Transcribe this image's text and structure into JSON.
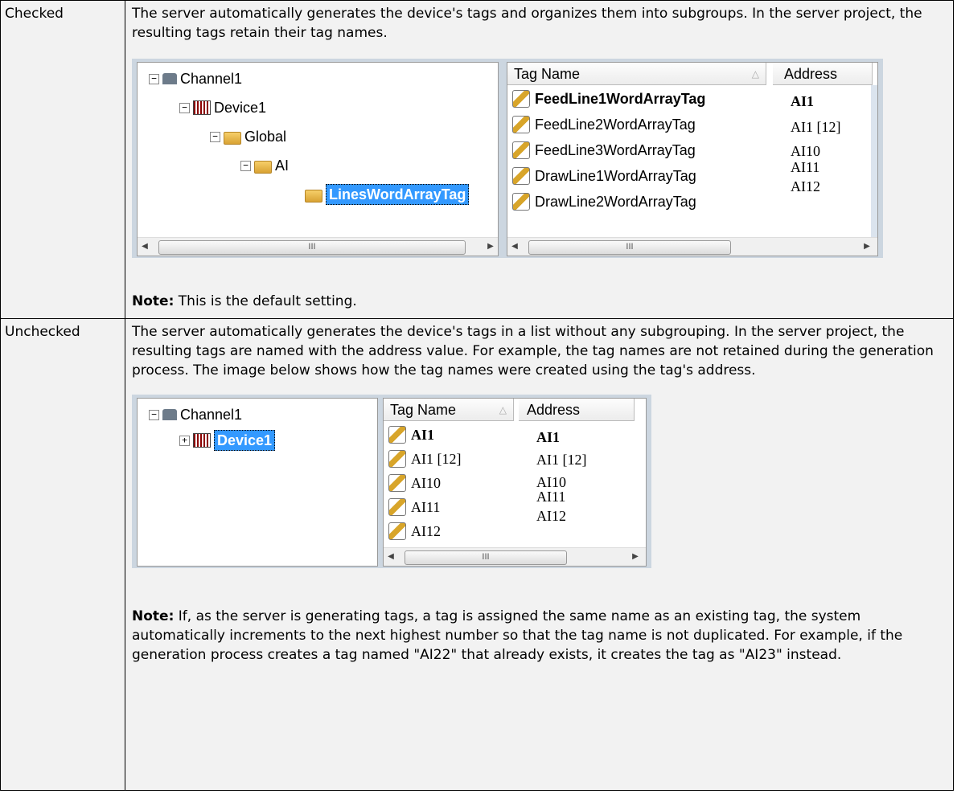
{
  "checked": {
    "label": "Checked",
    "description": "The server automatically generates the device's tags and organizes them into subgroups. In the server project, the resulting tags retain their tag names.",
    "note_label": "Note:",
    "note_text": " This is the default setting.",
    "tree": {
      "channel": "Channel1",
      "device": "Device1",
      "global": "Global",
      "ai": "AI",
      "selected": "LinesWordArrayTag"
    },
    "columns": {
      "tag_name": "Tag Name",
      "address": "Address"
    },
    "tags": [
      "FeedLine1WordArrayTag",
      "FeedLine2WordArrayTag",
      "FeedLine3WordArrayTag",
      "DrawLine1WordArrayTag",
      "DrawLine2WordArrayTag"
    ],
    "addresses": [
      "AI1",
      "AI1 [12]",
      "AI10",
      "AI11",
      "AI12"
    ],
    "scroll_thumb": "III"
  },
  "unchecked": {
    "label": "Unchecked",
    "description": "The server automatically generates the device's tags in a list without any subgrouping. In the server project, the resulting tags are named with the address value. For example, the tag names are not retained during the generation process. The image below shows how the tag names were created using the tag's address.",
    "note_label": "Note:",
    "note_text": " If, as the server is generating tags, a tag is assigned the same name as an existing tag, the system automatically increments to the next highest number so that the tag name is not duplicated. For example, if the generation process creates a tag named \"AI22\" that already exists, it creates the tag as \"AI23\" instead.",
    "tree": {
      "channel": "Channel1",
      "selected": "Device1"
    },
    "columns": {
      "tag_name": "Tag Name",
      "address": "Address"
    },
    "tags": [
      "AI1",
      "AI1 [12]",
      "AI10",
      "AI11",
      "AI12"
    ],
    "addresses": [
      "AI1",
      "AI1 [12]",
      "AI10",
      "AI11",
      "AI12"
    ],
    "scroll_thumb": "III"
  }
}
